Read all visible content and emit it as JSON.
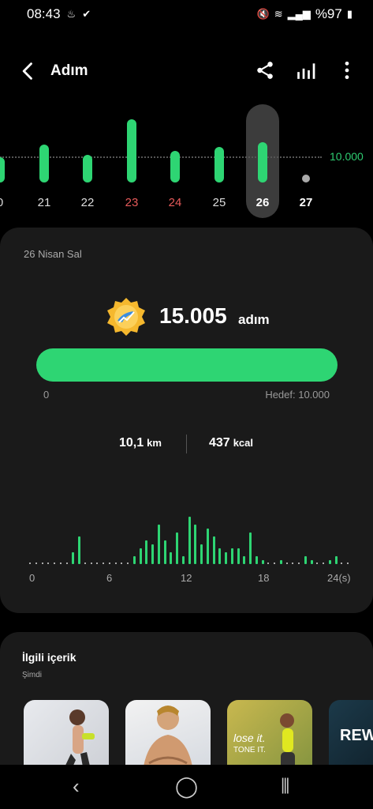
{
  "status": {
    "time": "08:43",
    "battery": "%97"
  },
  "header": {
    "title": "Adım"
  },
  "week": {
    "goal_label": "10.000",
    "days": [
      {
        "label": "0",
        "steps": 6000,
        "style": "normal"
      },
      {
        "label": "21",
        "steps": 9000,
        "style": "normal"
      },
      {
        "label": "22",
        "steps": 6500,
        "style": "normal"
      },
      {
        "label": "23",
        "steps": 15000,
        "style": "red"
      },
      {
        "label": "24",
        "steps": 7500,
        "style": "red"
      },
      {
        "label": "25",
        "steps": 8500,
        "style": "normal"
      },
      {
        "label": "26",
        "steps": 9500,
        "style": "selected"
      },
      {
        "label": "27",
        "steps": 0,
        "style": "bold"
      }
    ]
  },
  "summary": {
    "date": "26 Nisan Sal",
    "steps": "15.005",
    "steps_unit": "adım",
    "progress_zero": "0",
    "goal": "Hedef: 10.000",
    "distance_value": "10,1",
    "distance_unit": "km",
    "calories_value": "437",
    "calories_unit": "kcal"
  },
  "hourly": {
    "axis_labels": [
      "0",
      "6",
      "12",
      "18",
      "24(s)"
    ],
    "values": [
      0,
      0,
      0,
      0,
      0,
      0,
      0,
      15,
      35,
      0,
      0,
      0,
      0,
      0,
      0,
      0,
      0,
      10,
      20,
      30,
      25,
      50,
      30,
      15,
      40,
      10,
      60,
      50,
      25,
      45,
      35,
      20,
      15,
      20,
      20,
      10,
      40,
      10,
      5,
      0,
      0,
      5,
      0,
      0,
      0,
      10,
      5,
      0,
      0,
      5,
      10,
      0,
      0
    ]
  },
  "related": {
    "title": "İlgili içerik",
    "subtitle": "Şimdi",
    "cards": [
      {
        "caption_1": "",
        "caption_2": ""
      },
      {
        "caption_1": "",
        "caption_2": ""
      },
      {
        "caption_1": "lose it.",
        "caption_2": "TONE IT."
      },
      {
        "caption_1": "REW",
        "caption_2": ""
      }
    ]
  },
  "colors": {
    "accent": "#2ed573",
    "goal_text": "#2ecc71",
    "weekend": "#e65a5a"
  }
}
